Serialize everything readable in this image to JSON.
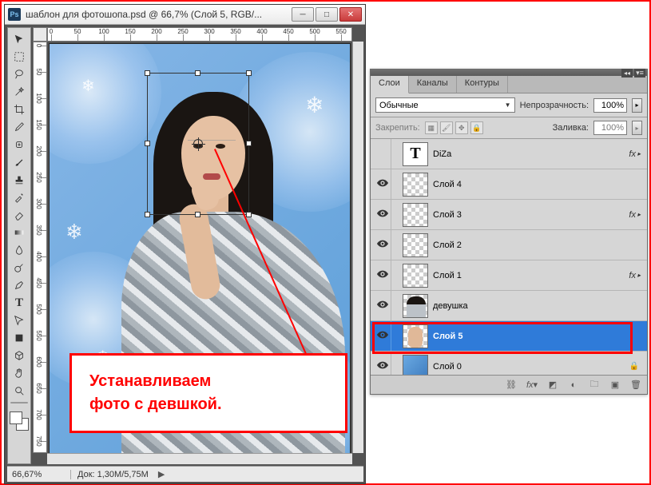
{
  "window": {
    "title": "шаблон для фотошопа.psd @ 66,7% (Слой 5, RGB/...",
    "ps_badge": "Ps"
  },
  "statusbar": {
    "zoom": "66,67%",
    "doc_info": "Док: 1,30M/5,75M"
  },
  "annotation": {
    "line1": "Устанавливаем",
    "line2": "фото с девшкой."
  },
  "panel": {
    "tabs": [
      "Слои",
      "Каналы",
      "Контуры"
    ],
    "active_tab": 0,
    "blend_mode": "Обычные",
    "opacity_label": "Непрозрачность:",
    "opacity_value": "100%",
    "lock_label": "Закрепить:",
    "fill_label": "Заливка:",
    "fill_value": "100%",
    "layers": [
      {
        "name": "DiZa",
        "visible": false,
        "thumb": "text",
        "fx": true
      },
      {
        "name": "Слой 4",
        "visible": true,
        "thumb": "checker",
        "fx": false
      },
      {
        "name": "Слой 3",
        "visible": true,
        "thumb": "checker",
        "fx": true
      },
      {
        "name": "Слой 2",
        "visible": true,
        "thumb": "checker",
        "fx": false
      },
      {
        "name": "Слой 1",
        "visible": true,
        "thumb": "checker",
        "fx": true
      },
      {
        "name": "девушка",
        "visible": true,
        "thumb": "girl",
        "fx": false
      },
      {
        "name": "Слой 5",
        "visible": true,
        "thumb": "face",
        "fx": false,
        "selected": true
      },
      {
        "name": "Слой 0",
        "visible": true,
        "thumb": "blue",
        "fx": false,
        "locked": true
      }
    ]
  },
  "tools": [
    "move",
    "marquee",
    "lasso",
    "wand",
    "crop",
    "eyedropper",
    "healing",
    "brush",
    "stamp",
    "history",
    "eraser",
    "gradient",
    "blur",
    "dodge",
    "pen",
    "type",
    "path",
    "shape",
    "3d",
    "hand",
    "zoom"
  ],
  "ruler": {
    "h_labels": [
      "0",
      "50",
      "100",
      "150",
      "200",
      "250",
      "300",
      "350",
      "400",
      "450",
      "500",
      "550"
    ],
    "v_labels": [
      "0",
      "50",
      "100",
      "150",
      "200",
      "250",
      "300",
      "350",
      "400",
      "450",
      "500",
      "550",
      "600",
      "650",
      "700",
      "750"
    ]
  }
}
